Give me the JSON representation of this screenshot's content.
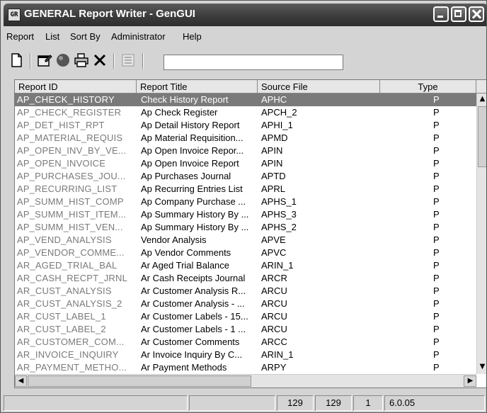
{
  "window": {
    "title": "GENERAL Report Writer - GenGUI",
    "app_icon_glyph": "GR"
  },
  "menu": [
    "Report",
    "List",
    "Sort By",
    "Administrator",
    "Help"
  ],
  "toolbar": {
    "icons": [
      "new-document-icon",
      "properties-icon",
      "run-circle-icon",
      "print-icon",
      "delete-x-icon",
      "list-view-icon"
    ],
    "input_value": ""
  },
  "list": {
    "columns": [
      "Report ID",
      "Report Title",
      "Source File",
      "Type"
    ],
    "selected_index": 0,
    "rows": [
      [
        "AP_CHECK_HISTORY",
        "Check History Report",
        "APHC",
        "P"
      ],
      [
        "AP_CHECK_REGISTER",
        "Ap Check Register",
        "APCH_2",
        "P"
      ],
      [
        "AP_DET_HIST_RPT",
        "Ap Detail History Report",
        "APHI_1",
        "P"
      ],
      [
        "AP_MATERIAL_REQUIS",
        "Ap Material Requisition...",
        "APMD",
        "P"
      ],
      [
        "AP_OPEN_INV_BY_VE...",
        "Ap Open Invoice Repor...",
        "APIN",
        "P"
      ],
      [
        "AP_OPEN_INVOICE",
        "Ap Open Invoice Report",
        "APIN",
        "P"
      ],
      [
        "AP_PURCHASES_JOU...",
        "Ap Purchases Journal",
        "APTD",
        "P"
      ],
      [
        "AP_RECURRING_LIST",
        "Ap Recurring Entries List",
        "APRL",
        "P"
      ],
      [
        "AP_SUMM_HIST_COMP",
        "Ap Company Purchase ...",
        "APHS_1",
        "P"
      ],
      [
        "AP_SUMM_HIST_ITEM...",
        "Ap Summary History By ...",
        "APHS_3",
        "P"
      ],
      [
        "AP_SUMM_HIST_VEN...",
        "Ap Summary History By ...",
        "APHS_2",
        "P"
      ],
      [
        "AP_VEND_ANALYSIS",
        "Vendor Analysis",
        "APVE",
        "P"
      ],
      [
        "AP_VENDOR_COMME...",
        "Ap Vendor Comments",
        "APVC",
        "P"
      ],
      [
        "AR_AGED_TRIAL_BAL",
        "Ar Aged Trial Balance",
        "ARIN_1",
        "P"
      ],
      [
        "AR_CASH_RECPT_JRNL",
        "Ar Cash Receipts Journal",
        "ARCR",
        "P"
      ],
      [
        "AR_CUST_ANALYSIS",
        "Ar Customer Analysis R...",
        "ARCU",
        "P"
      ],
      [
        "AR_CUST_ANALYSIS_2",
        "Ar Customer Analysis - ...",
        "ARCU",
        "P"
      ],
      [
        "AR_CUST_LABEL_1",
        "Ar Customer Labels - 15...",
        "ARCU",
        "P"
      ],
      [
        "AR_CUST_LABEL_2",
        "Ar Customer Labels - 1 ...",
        "ARCU",
        "P"
      ],
      [
        "AR_CUSTOMER_COM...",
        "Ar Customer Comments",
        "ARCC",
        "P"
      ],
      [
        "AR_INVOICE_INQUIRY",
        "Ar Invoice Inquiry By C...",
        "ARIN_1",
        "P"
      ],
      [
        "AR_PAYMENT_METHO...",
        "Ar Payment Methods",
        "ARPY",
        "P"
      ]
    ]
  },
  "status": {
    "panel1": "",
    "panel2": "",
    "count_a": "129",
    "count_b": "129",
    "position": "1",
    "version": "6.0.05"
  }
}
